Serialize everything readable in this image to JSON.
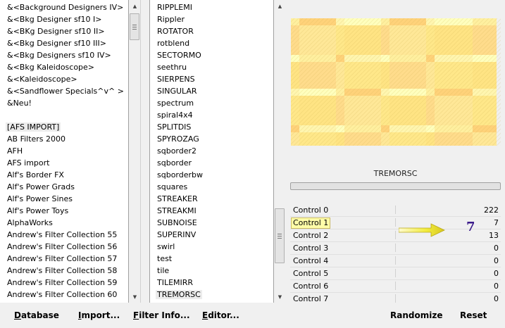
{
  "categories": {
    "items": [
      "&<Background Designers IV>",
      "&<Bkg Designer sf10 I>",
      "&<BKg Designer sf10 II>",
      "&<Bkg Designer sf10 III>",
      "&<Bkg Designers sf10 IV>",
      "&<Bkg Kaleidoscope>",
      "&<Kaleidoscope>",
      "&<Sandflower Specials^v^ >",
      "&Neu!",
      "",
      "[AFS IMPORT]",
      "AB Filters 2000",
      "AFH",
      "AFS import",
      "Alf's Border FX",
      "Alf's Power Grads",
      "Alf's Power Sines",
      "Alf's Power Toys",
      "AlphaWorks",
      "Andrew's Filter Collection 55",
      "Andrew's Filter Collection 56",
      "Andrew's Filter Collection 57",
      "Andrew's Filter Collection 58",
      "Andrew's Filter Collection 59",
      "Andrew's Filter Collection 60"
    ]
  },
  "filters": {
    "items": [
      "RIPPLEMI",
      "Rippler",
      "ROTATOR",
      "rotblend",
      "SECTORMO",
      "seethru",
      "SIERPENS",
      "SINGULAR",
      "spectrum",
      "spiral4x4",
      "SPLITDIS",
      "SPYROZAG",
      "sqborder2",
      "sqborder",
      "sqborderbw",
      "squares",
      "STREAKER",
      "STREAKMI",
      "SUBNOISE",
      "SUPERINV",
      "swirl",
      "test",
      "tile",
      "TILEMIRR",
      "TREMORSC"
    ]
  },
  "preview": {
    "colors": [
      "#fff0a0",
      "#ffe484",
      "#ffd27a",
      "#ffdc8c",
      "#fff6b0",
      "#ffe898",
      "#ffffbe",
      "#ffe88a"
    ]
  },
  "filter_name": "TREMORSC",
  "controls": [
    {
      "label": "Control 0",
      "value": "222"
    },
    {
      "label": "Control 1",
      "value": "7"
    },
    {
      "label": "Control 2",
      "value": "13"
    },
    {
      "label": "Control 3",
      "value": "0"
    },
    {
      "label": "Control 4",
      "value": "0"
    },
    {
      "label": "Control 5",
      "value": "0"
    },
    {
      "label": "Control 6",
      "value": "0"
    },
    {
      "label": "Control 7",
      "value": "0"
    }
  ],
  "annotation": {
    "number": "7",
    "arrow_color": "#f2ec3c"
  },
  "buttons": {
    "database": {
      "label": "Database",
      "underline": "D",
      "rest": "atabase"
    },
    "import": {
      "label": "Import...",
      "underline": "I",
      "rest": "mport..."
    },
    "filter_info": {
      "label": "Filter Info...",
      "underline": "F",
      "rest": "ilter Info..."
    },
    "editor": {
      "label": "Editor...",
      "underline": "E",
      "rest": "ditor..."
    },
    "randomize": {
      "label": "Randomize"
    },
    "reset": {
      "label": "Reset"
    }
  }
}
